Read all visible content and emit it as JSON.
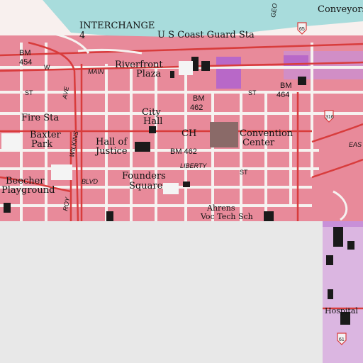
{
  "map": {
    "labels": {
      "interchange": "INTERCHANGE",
      "interchange_num": "4",
      "coast_guard": "U S Coast Guard Sta",
      "conveyors": "Conveyors",
      "bm454": "BM",
      "bm454_num": "454",
      "w": "W",
      "main": "MAIN",
      "riverfront": "Riverfront",
      "plaza": "Plaza",
      "bm464": "BM",
      "bm464_num": "464",
      "st_left": "ST",
      "st_mid": "ST",
      "bm462a": "BM",
      "bm462a_num": "462",
      "fire_sta": "Fire Sta",
      "city": "City",
      "hall": "Hall",
      "ch": "CH",
      "convention": "Convention",
      "center": "Center",
      "baxter": "Baxter",
      "park": "Park",
      "hall_of": "Hall of",
      "justice": "Justice",
      "bm462b": "BM 462",
      "liberty": "LIBERTY",
      "founders": "Founders",
      "square": "Square",
      "beecher": "Beecher",
      "playground": "Playground",
      "blvd": "BLVD",
      "st_low": "ST",
      "ahrens": "Ahrens",
      "voc_tech": "Voc Tech Sch",
      "hospital": "Hospital",
      "wilkins": "WILKINS",
      "ave": "AVE",
      "roy": "ROY",
      "geo": "GEO",
      "east": "EAS",
      "shield65": "65",
      "shield316": "316",
      "shield61": "61"
    },
    "colors": {
      "river": "#a8dcdc",
      "urban": "#e88a9a",
      "street": "#f4f4f4",
      "road_red": "#d83c3c",
      "building": "#1a1a1a",
      "purple": "#b868c8",
      "nodata": "#e8e8e8",
      "pale": "#f8f0ee"
    }
  }
}
